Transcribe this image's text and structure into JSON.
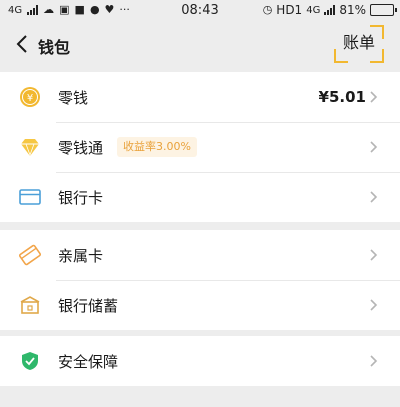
{
  "status_bar": {
    "network": "4G",
    "time": "08:43",
    "hd_label": "HD1",
    "network_small": "4G",
    "battery_percent": "81%",
    "battery_level": 0.81
  },
  "header": {
    "title": "钱包",
    "bill_label": "账单"
  },
  "groups": [
    {
      "items": [
        {
          "label": "零钱",
          "value": "¥5.01",
          "icon": "yuan-coin-icon"
        },
        {
          "label": "零钱通",
          "badge": "收益率3.00%",
          "icon": "diamond-icon"
        },
        {
          "label": "银行卡",
          "icon": "bank-card-icon"
        }
      ]
    },
    {
      "items": [
        {
          "label": "亲属卡",
          "icon": "family-card-icon"
        },
        {
          "label": "银行储蓄",
          "icon": "bank-savings-icon"
        }
      ]
    },
    {
      "items": [
        {
          "label": "安全保障",
          "icon": "shield-icon"
        }
      ]
    }
  ],
  "colors": {
    "accent_yellow": "#f2b830",
    "badge_text": "#e9a23b",
    "card_blue": "#4a9fd8",
    "shield_green": "#2fb86b",
    "background": "#ededed"
  }
}
